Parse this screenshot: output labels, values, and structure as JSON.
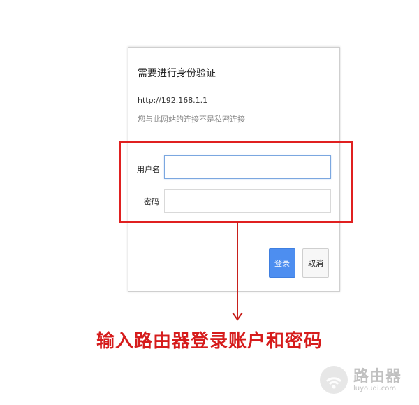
{
  "dialog": {
    "title": "需要进行身份验证",
    "url": "http://192.168.1.1",
    "notice": "您与此网站的连接不是私密连接",
    "username_label": "用户名",
    "password_label": "密码",
    "username_value": "",
    "password_value": "",
    "login_button": "登录",
    "cancel_button": "取消"
  },
  "annotation": {
    "caption": "输入路由器登录账户和密码",
    "highlight_color": "#e02020",
    "arrow_color": "#c8201c"
  },
  "watermark": {
    "name": "路由器",
    "url": "luyouqi.com",
    "icon": "router-wifi-icon"
  },
  "colors": {
    "login_button": "#4d8ef0",
    "caption": "#d61c1c"
  }
}
